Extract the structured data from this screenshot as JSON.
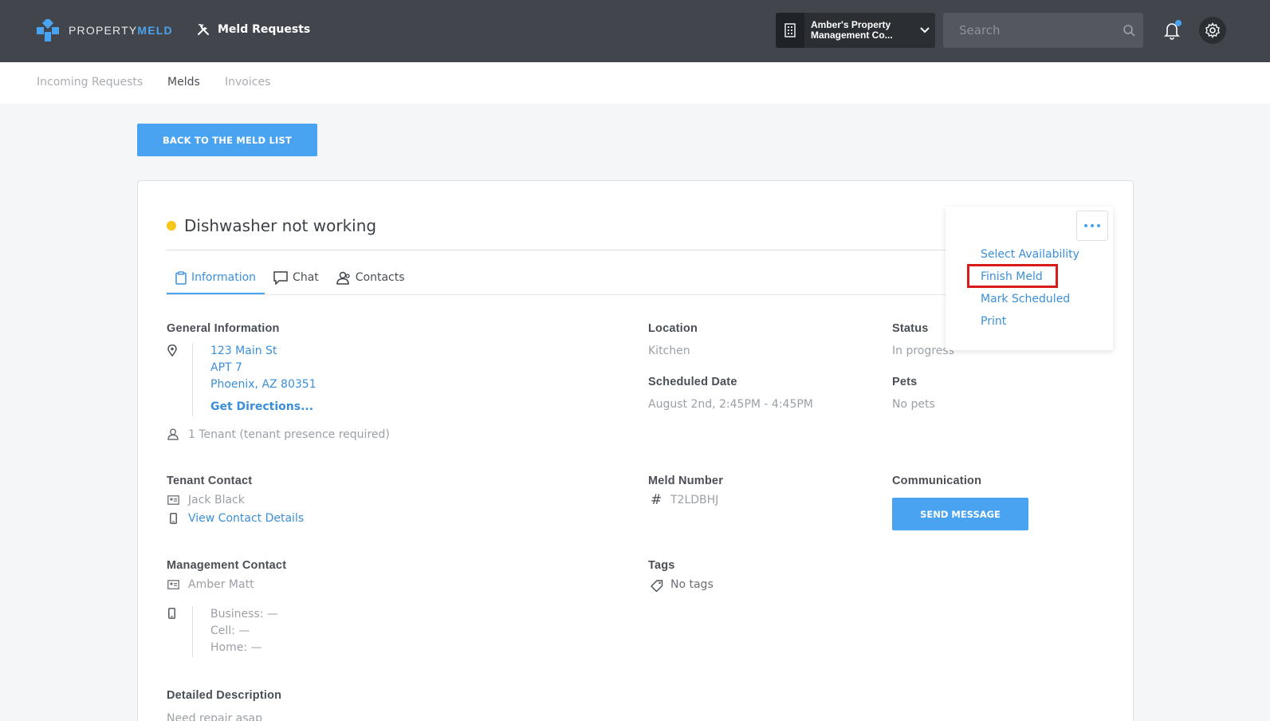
{
  "brand": {
    "name_part1": "PROPERTY",
    "name_part2": "MELD",
    "accent": "#4aa3f0"
  },
  "header": {
    "app_title": "Meld Requests",
    "org_line1": "Amber's Property",
    "org_line2": "Management Co...",
    "search_placeholder": "Search"
  },
  "subnav": [
    "Incoming Requests",
    "Melds",
    "Invoices"
  ],
  "back_button": "BACK TO THE MELD LIST",
  "meld": {
    "title": "Dishwasher not working",
    "status_color": "#f5c518",
    "tabs": [
      "Information",
      "Chat",
      "Contacts"
    ]
  },
  "general": {
    "heading": "General Information",
    "address": [
      "123 Main St",
      "APT 7",
      "Phoenix, AZ 80351"
    ],
    "directions": "Get Directions...",
    "tenants": "1 Tenant (tenant presence required)"
  },
  "location": {
    "heading": "Location",
    "value": "Kitchen"
  },
  "status": {
    "heading": "Status",
    "value": "In progress"
  },
  "scheduled": {
    "heading": "Scheduled Date",
    "value": "August 2nd, 2:45PM - 4:45PM"
  },
  "pets": {
    "heading": "Pets",
    "value": "No pets"
  },
  "tenant_contact": {
    "heading": "Tenant Contact",
    "name": "Jack Black",
    "details_link": "View Contact Details"
  },
  "meld_number": {
    "heading": "Meld Number",
    "value": "T2LDBHJ"
  },
  "communication": {
    "heading": "Communication",
    "button": "SEND MESSAGE"
  },
  "management_contact": {
    "heading": "Management Contact",
    "name": "Amber Matt",
    "business": "Business: —",
    "cell": "Cell: —",
    "home": "Home: —"
  },
  "tags": {
    "heading": "Tags",
    "value": "No tags"
  },
  "description": {
    "heading": "Detailed Description",
    "value": "Need repair asap"
  },
  "actions_menu": [
    "Select Availability",
    "Finish Meld",
    "Mark Scheduled",
    "Print"
  ]
}
